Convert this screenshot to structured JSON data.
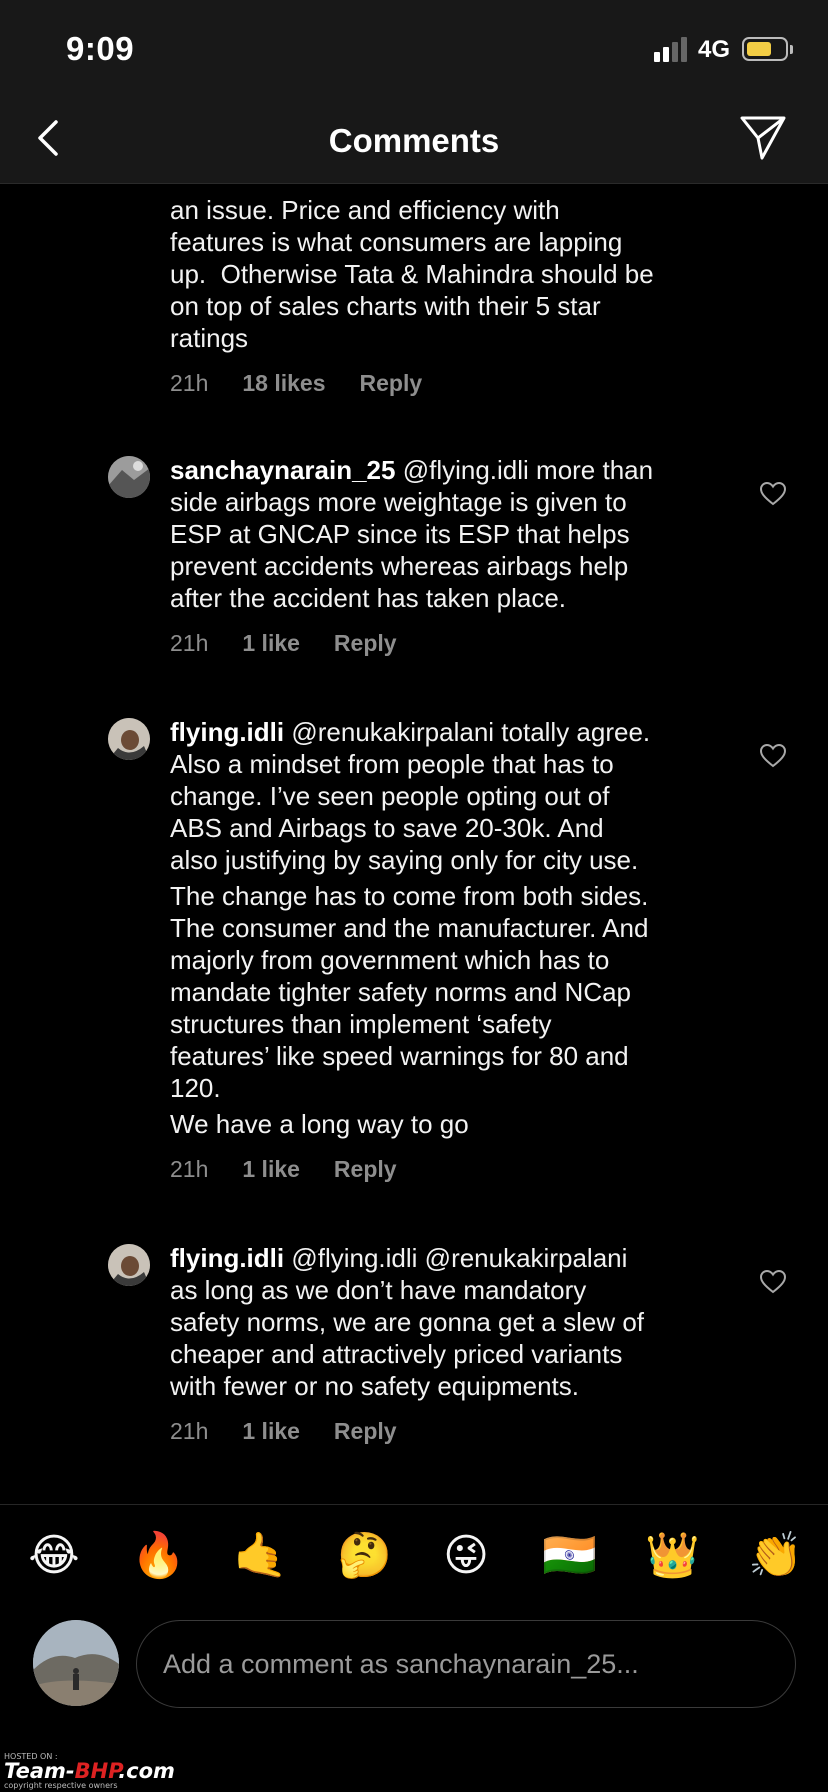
{
  "status_bar": {
    "time": "9:09",
    "network": "4G",
    "battery_level": 0.55,
    "battery_color": "#f2cd45"
  },
  "header": {
    "title": "Comments",
    "back_icon": "chevron-left-icon",
    "send_icon": "paper-plane-icon"
  },
  "comments": [
    {
      "lines": [
        "an issue. Price and efficiency with",
        "features is what consumers are lapping",
        "up.  Otherwise Tata & Mahindra should be",
        "on top of sales charts with their 5 star",
        "ratings"
      ],
      "time": "21h",
      "likes": "18 likes",
      "reply": "Reply"
    },
    {
      "username": "sanchaynarain_25",
      "first_line": "@flying.idli more than",
      "lines": [
        "side airbags more weightage is given to",
        "ESP at GNCAP since its ESP that helps",
        "prevent accidents whereas airbags help",
        "after the accident has taken place."
      ],
      "time": "21h",
      "likes": "1 like",
      "reply": "Reply"
    },
    {
      "username": "flying.idli",
      "first_line": "@renukakirpalani totally agree.",
      "lines": [
        "Also a mindset from people that has to",
        "change. I’ve seen people opting out of",
        "ABS and Airbags to save 20-30k. And",
        "also justifying by saying only for city use."
      ],
      "para2": [
        "The change has to come from both sides.",
        "The consumer and the manufacturer. And",
        "majorly from government which has to",
        "mandate tighter safety norms and NCap",
        "structures than implement ‘safety",
        "features’ like speed warnings for 80 and",
        "120."
      ],
      "para3": "We have a long way to go",
      "time": "21h",
      "likes": "1 like",
      "reply": "Reply"
    },
    {
      "username": "flying.idli",
      "first_line": "@flying.idli @renukakirpalani",
      "lines": [
        "as long as we don’t have mandatory",
        "safety norms, we are gonna get a slew of",
        "cheaper and attractively priced variants",
        "with fewer or no safety equipments."
      ],
      "time": "21h",
      "likes": "1 like",
      "reply": "Reply"
    }
  ],
  "emoji_bar": [
    "😂",
    "🔥",
    "🤙",
    "🤔",
    "😜",
    "🇮🇳",
    "👑",
    "👏"
  ],
  "composer": {
    "placeholder": "Add a comment as sanchaynarain_25..."
  },
  "watermark": {
    "small": "HOSTED ON :",
    "brand_a": "Team-",
    "brand_b": "BHP",
    "brand_c": ".com",
    "tag": "copyright respective owners"
  }
}
